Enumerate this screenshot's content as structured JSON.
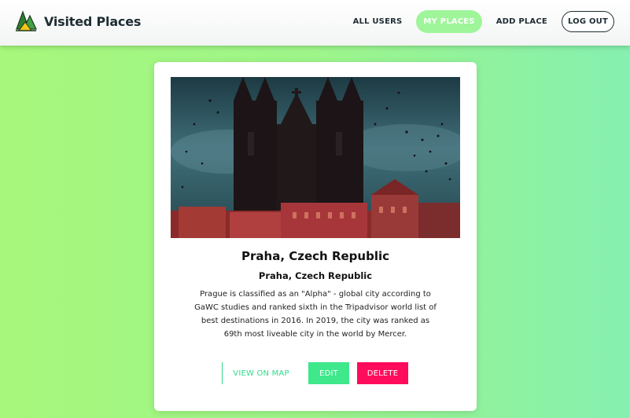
{
  "header": {
    "brand_title": "Visited Places",
    "brand_icon": "mountain-tent-icon",
    "nav": {
      "all_users": "ALL USERS",
      "my_places": "MY PLACES",
      "add_place": "ADD PLACE",
      "log_out": "LOG OUT"
    }
  },
  "place": {
    "title": "Praha, Czech Republic",
    "subtitle": "Praha, Czech Republic",
    "description": "Prague is classified as an \"Alpha\" - global city according to GaWC studies and ranked sixth in the Tripadvisor world list of best destinations in 2016. In 2019, the city was ranked as 69th most liveable city in the world by Mercer.",
    "image_icon": "church-photo-image"
  },
  "actions": {
    "view_on_map": "VIEW ON MAP",
    "edit": "EDIT",
    "delete": "DELETE"
  },
  "colors": {
    "accent_green": "#3ee88b",
    "delete_red": "#ff0d5c",
    "active_nav": "#9ef59a",
    "text_dark": "#1f2d33"
  }
}
